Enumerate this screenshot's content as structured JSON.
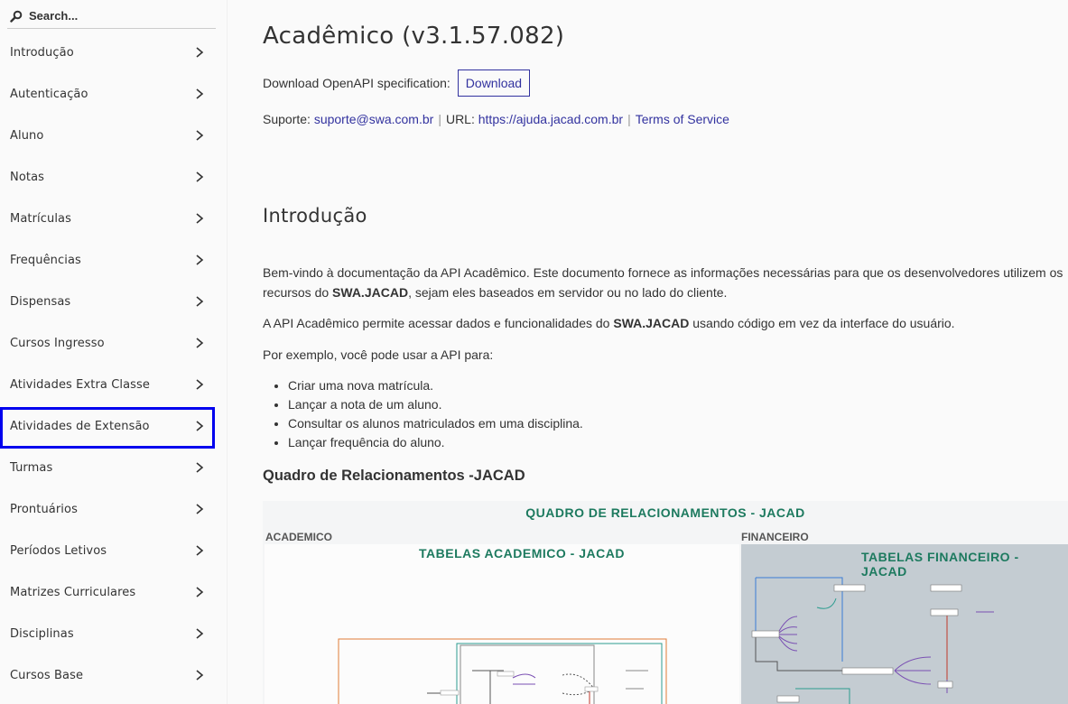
{
  "search": {
    "placeholder": "Search..."
  },
  "sidebar": {
    "items": [
      {
        "label": "Introdução"
      },
      {
        "label": "Autenticação"
      },
      {
        "label": "Aluno"
      },
      {
        "label": "Notas"
      },
      {
        "label": "Matrículas"
      },
      {
        "label": "Frequências"
      },
      {
        "label": "Dispensas"
      },
      {
        "label": "Cursos Ingresso"
      },
      {
        "label": "Atividades Extra Classe"
      },
      {
        "label": "Atividades de Extensão",
        "selected": true
      },
      {
        "label": "Turmas"
      },
      {
        "label": "Prontuários"
      },
      {
        "label": "Períodos Letivos"
      },
      {
        "label": "Matrizes Curriculares"
      },
      {
        "label": "Disciplinas"
      },
      {
        "label": "Cursos Base"
      }
    ]
  },
  "main": {
    "title": "Acadêmico (v3.1.57.082)",
    "download_label": "Download OpenAPI specification:",
    "download_button": "Download",
    "support_label": "Suporte:",
    "support_email": "suporte@swa.com.br",
    "url_label": "URL:",
    "url": "https://ajuda.jacad.com.br",
    "terms": "Terms of Service",
    "section_title": "Introdução",
    "p1_a": "Bem-vindo à documentação da API Acadêmico. Este documento fornece as informações necessárias para que os desenvolvedores utilizem os recursos do ",
    "p1_b": "SWA.JACAD",
    "p1_c": ", sejam eles baseados em servidor ou no lado do cliente.",
    "p2_a": "A API Acadêmico permite acessar dados e funcionalidades do ",
    "p2_b": "SWA.JACAD",
    "p2_c": " usando código em vez da interface do usuário.",
    "p3": "Por exemplo, você pode usar a API para:",
    "bullets": [
      "Criar uma nova matrícula.",
      "Lançar a nota de um aluno.",
      "Consultar os alunos matriculados em uma disciplina.",
      "Lançar frequência do aluno."
    ],
    "diagram_heading": "Quadro de Relacionamentos -JACAD"
  },
  "diagram": {
    "title": "QUADRO DE RELACIONAMENTOS - JACAD",
    "academico_label": "ACADEMICO",
    "financeiro_label": "FINANCEIRO",
    "academico_title": "TABELAS ACADEMICO - JACAD",
    "financeiro_title": "TABELAS FINANCEIRO - JACAD"
  },
  "colors": {
    "link": "#32329f",
    "selected_outline": "#0000ee",
    "diagram_title": "#1d7a5f",
    "financeiro_bg": "#c4ccd2"
  },
  "icons": {
    "search": "search-icon",
    "chevron": "chevron-right-icon"
  }
}
